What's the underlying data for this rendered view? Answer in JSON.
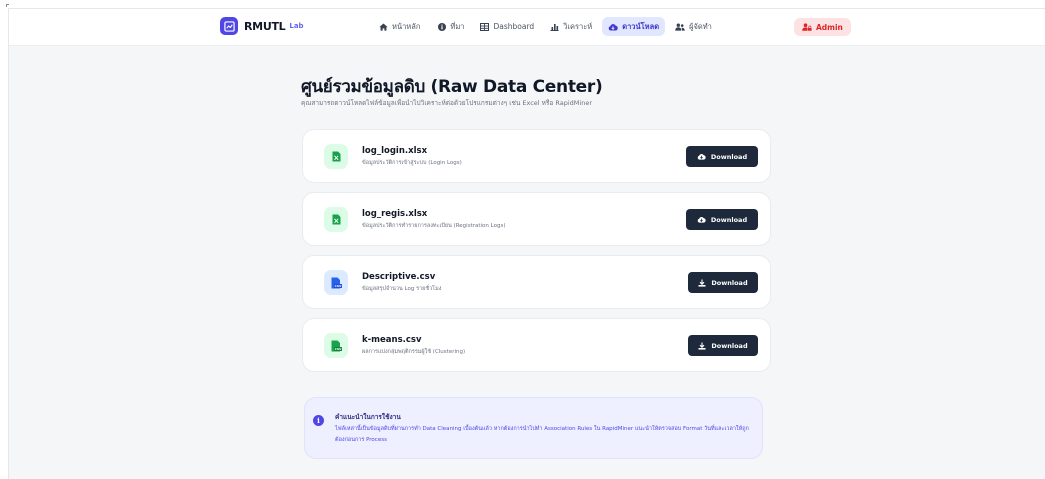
{
  "brand": {
    "name": "RMUTL",
    "sub": "Lab"
  },
  "nav": {
    "items": [
      {
        "label": "หน้าหลัก",
        "icon": "home-icon"
      },
      {
        "label": "ที่มา",
        "icon": "info-icon"
      },
      {
        "label": "Dashboard",
        "icon": "table-icon"
      },
      {
        "label": "วิเคราะห์",
        "icon": "chart-icon"
      },
      {
        "label": "ดาวน์โหลด",
        "icon": "cloud-download-icon",
        "active": true
      },
      {
        "label": "ผู้จัดทำ",
        "icon": "users-icon"
      }
    ],
    "admin_label": "Admin"
  },
  "header": {
    "title": "ศูนย์รวมข้อมูลดิบ (Raw Data Center)",
    "subtitle": "คุณสามารถดาวน์โหลดไฟล์ข้อมูลเพื่อนำไปวิเคราะห์ต่อด้วยโปรแกรมต่างๆ เช่น Excel หรือ RapidMiner"
  },
  "files": [
    {
      "name": "log_login.xlsx",
      "desc": "ข้อมูลประวัติการเข้าสู่ระบบ (Login Logs)",
      "type": "xlsx",
      "button": "Download",
      "button_icon": "cloud-download-icon"
    },
    {
      "name": "log_regis.xlsx",
      "desc": "ข้อมูลประวัติการทำรายการลงทะเบียน (Registration Logs)",
      "type": "xlsx",
      "button": "Download",
      "button_icon": "cloud-download-icon"
    },
    {
      "name": "Descriptive.csv",
      "desc": "ข้อมูลสรุปจำนวน Log รายชั่วโมง",
      "type": "csv-blue",
      "button": "Download",
      "button_icon": "download-icon"
    },
    {
      "name": "k-means.csv",
      "desc": "ผลการแบ่งกลุ่มพฤติกรรมผู้ใช้ (Clustering)",
      "type": "csv-green",
      "button": "Download",
      "button_icon": "download-icon"
    }
  ],
  "info": {
    "title": "คำแนะนำในการใช้งาน",
    "text": "ไฟล์เหล่านี้เป็นข้อมูลดิบที่ผ่านการทำ Data Cleaning เบื้องต้นแล้ว หากต้องการนำไปทำ Association Rules ใน RapidMiner แนะนำให้ตรวจสอบ Format วันที่และเวลาให้ถูกต้องก่อนการ Process"
  },
  "colors": {
    "brand": "#4f46e5",
    "button": "#1e293b",
    "admin": "#dc2626",
    "xlsx": "#16a34a",
    "csv": "#2563eb"
  }
}
